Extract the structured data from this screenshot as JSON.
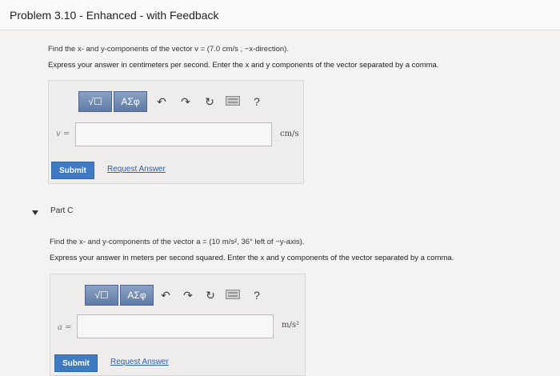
{
  "header": {
    "title": "Problem 3.10 - Enhanced - with Feedback"
  },
  "part_b": {
    "prompt": "Find the x- and y-components of the vector v = (7.0 cm/s , −x-direction).",
    "instruction": "Express your answer in centimeters per second. Enter the x and y components of the vector separated by a comma.",
    "toolbar": {
      "template_label": "√☐",
      "greek_label": "ΑΣφ",
      "help_label": "?"
    },
    "answer_label": "v =",
    "unit": "cm/s",
    "submit_label": "Submit",
    "request_label": "Request Answer"
  },
  "part_c": {
    "title": "Part C",
    "prompt": "Find the x- and y-components of the vector a = (10 m/s², 36° left of −y-axis).",
    "instruction": "Express your answer in meters per second squared. Enter the x and y components of the vector separated by a comma.",
    "toolbar": {
      "template_label": "√☐",
      "greek_label": "ΑΣφ",
      "help_label": "?"
    },
    "answer_label": "a =",
    "unit": "m/s²",
    "submit_label": "Submit",
    "request_label": "Request Answer"
  },
  "icons": {
    "undo": "undo-icon",
    "redo": "redo-icon",
    "reset": "reset-icon",
    "keyboard": "keyboard-icon",
    "help": "help-icon",
    "collapse": "caret-down-icon"
  },
  "colors": {
    "toolbar_blue": "#5f7ba6",
    "submit_blue": "#3f7bc4",
    "link_blue": "#2a62b0"
  }
}
